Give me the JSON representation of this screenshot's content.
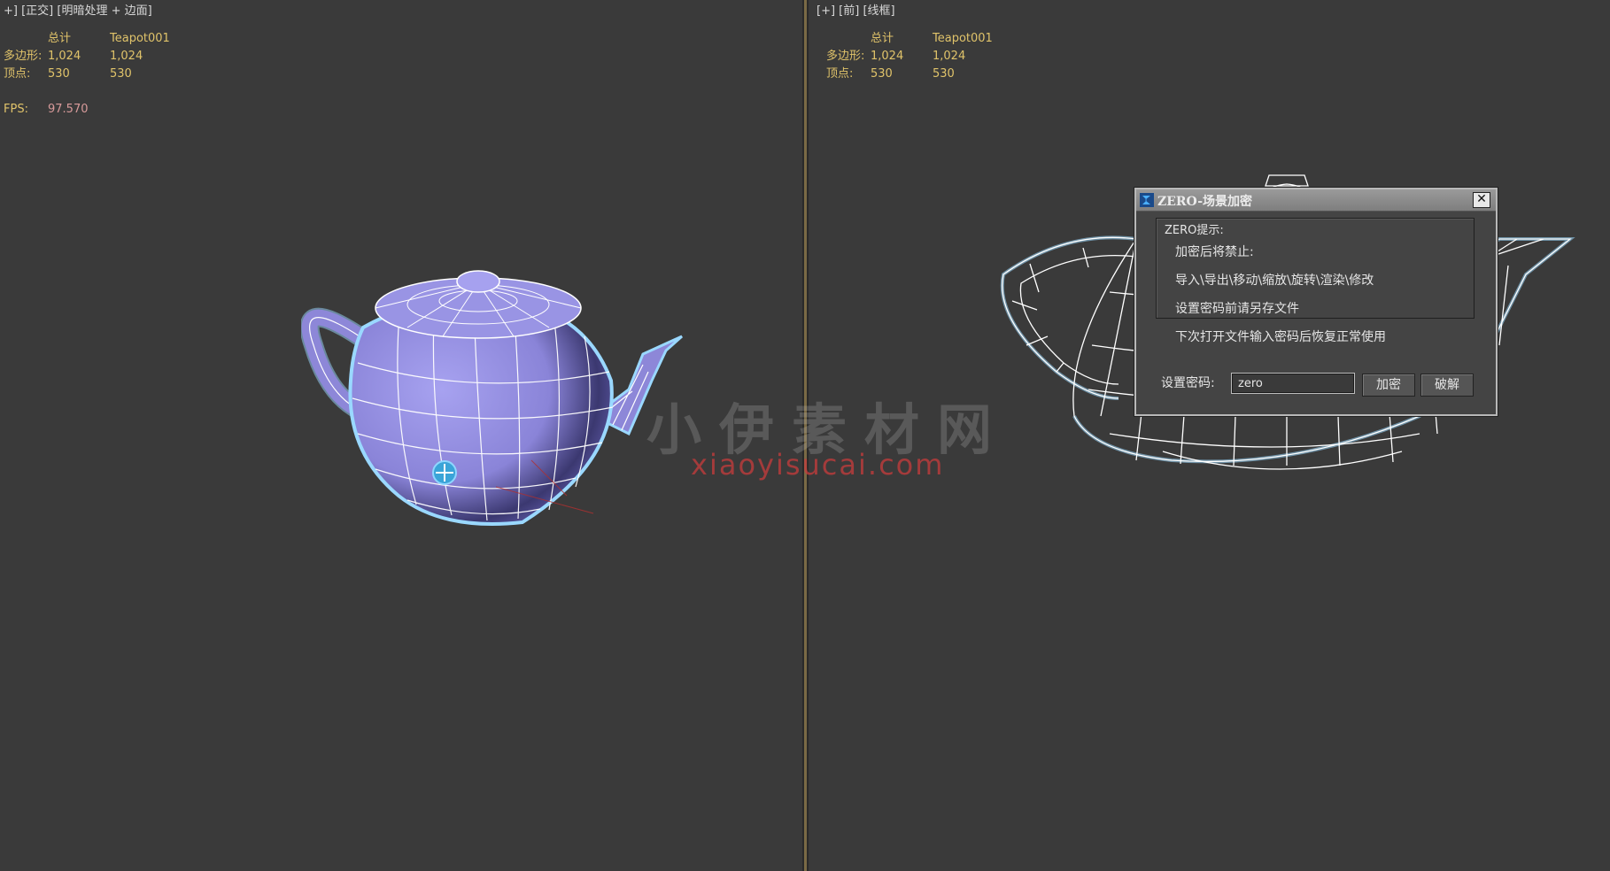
{
  "left_viewport": {
    "label": "+] [正交] [明暗处理 + 边面]",
    "stats": {
      "header_total": "总计",
      "header_object": "Teapot001",
      "polygons_label": "多边形:",
      "polygons_total": "1,024",
      "polygons_object": "1,024",
      "vertices_label": "顶点:",
      "vertices_total": "530",
      "vertices_object": "530",
      "fps_label": "FPS:",
      "fps_value": "97.570"
    }
  },
  "right_viewport": {
    "label": "[+] [前] [线框]",
    "stats": {
      "header_total": "总计",
      "header_object": "Teapot001",
      "polygons_label": "多边形:",
      "polygons_total": "1,024",
      "polygons_object": "1,024",
      "vertices_label": "顶点:",
      "vertices_total": "530",
      "vertices_object": "530"
    }
  },
  "watermark": {
    "chinese": "小伊素材网",
    "url": "xiaoyisucai.com"
  },
  "dialog": {
    "title": "ZERO-场景加密",
    "close_label": "✕",
    "group_title": "ZERO提示:",
    "lines": [
      "加密后将禁止:",
      "导入\\导出\\移动\\缩放\\旋转\\渲染\\修改",
      "设置密码前请另存文件",
      "下次打开文件输入密码后恢复正常使用"
    ],
    "password_label": "设置密码:",
    "password_value": "zero",
    "encrypt_label": "加密",
    "crack_label": "破解"
  },
  "colors": {
    "viewport_bg": "#3a3a3a",
    "stats_text": "#e0c36a",
    "teapot_shaded": "#8c86d8",
    "wire": "#ffffff",
    "selection_glow": "#9ad8ff"
  }
}
